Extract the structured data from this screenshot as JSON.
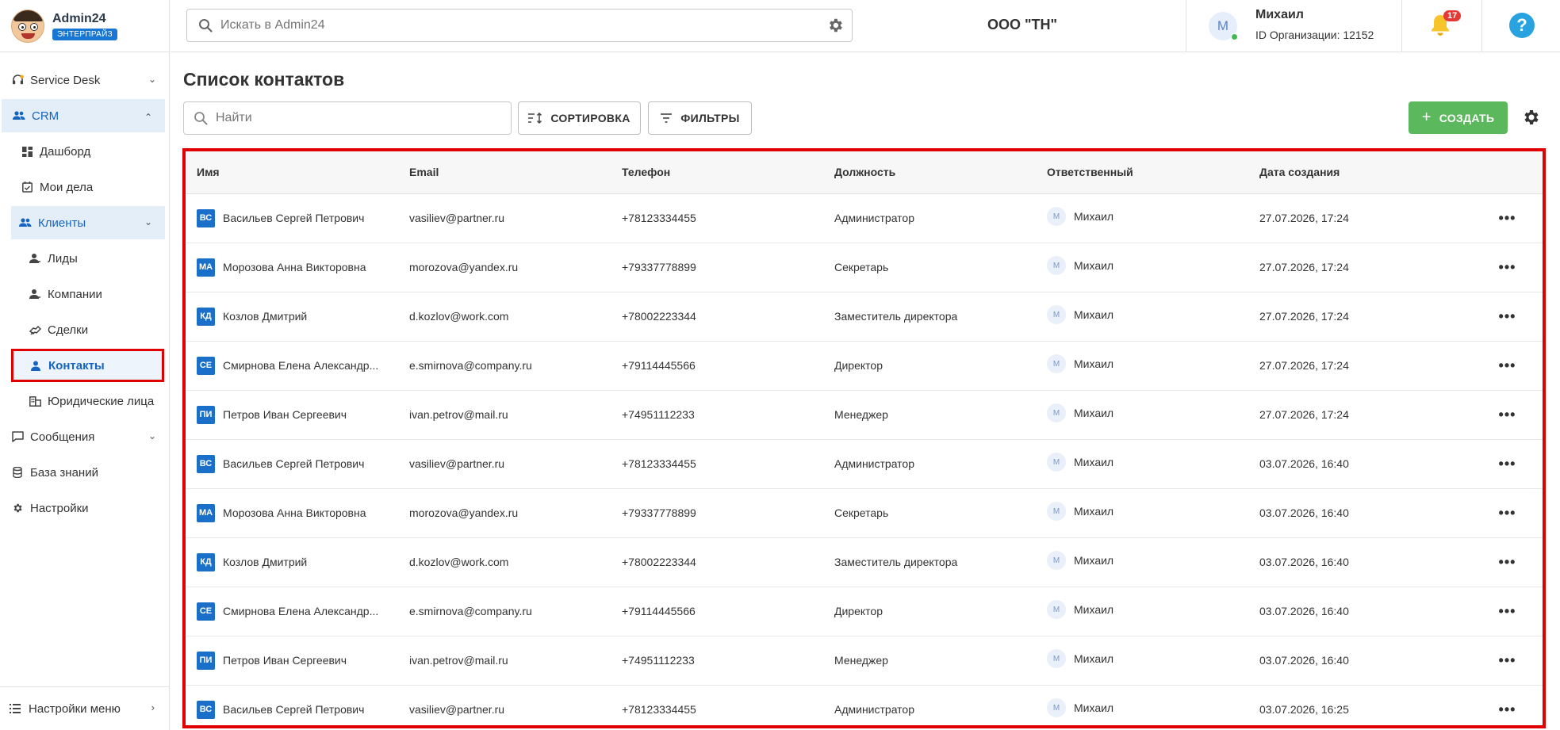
{
  "brand": {
    "title": "Admin24",
    "badge": "ЭНТЕРПРАЙЗ"
  },
  "sidebar": {
    "items": [
      {
        "label": "Service Desk",
        "icon": "headset-icon"
      },
      {
        "label": "CRM",
        "icon": "people-icon"
      },
      {
        "label": "Дашборд",
        "icon": "dashboard-icon"
      },
      {
        "label": "Мои дела",
        "icon": "calendar-check-icon"
      },
      {
        "label": "Клиенты",
        "icon": "clients-icon"
      },
      {
        "label": "Лиды",
        "icon": "lead-icon"
      },
      {
        "label": "Компании",
        "icon": "company-icon"
      },
      {
        "label": "Сделки",
        "icon": "handshake-icon"
      },
      {
        "label": "Контакты",
        "icon": "person-icon"
      },
      {
        "label": "Юридические лица",
        "icon": "building-icon"
      },
      {
        "label": "Сообщения",
        "icon": "chat-icon"
      },
      {
        "label": "База знаний",
        "icon": "database-icon"
      },
      {
        "label": "Настройки",
        "icon": "gear-icon"
      }
    ],
    "footer": "Настройки меню"
  },
  "header": {
    "search_placeholder": "Искать в Admin24",
    "org_name": "ООО \"ТН\"",
    "user_initial": "М",
    "user_name": "Михаил",
    "user_org": "ID Организации: 12152",
    "notifications": "17",
    "help": "?"
  },
  "main": {
    "title": "Список контактов",
    "find_placeholder": "Найти",
    "sort_label": "СОРТИРОВКА",
    "filter_label": "ФИЛЬТРЫ",
    "create_label": "СОЗДАТЬ"
  },
  "table": {
    "columns": [
      "Имя",
      "Email",
      "Телефон",
      "Должность",
      "Ответственный",
      "Дата создания"
    ],
    "rows": [
      {
        "initials": "ВС",
        "name": "Васильев Сергей Петрович",
        "email": "vasiliev@partner.ru",
        "phone": "+78123334455",
        "position": "Администратор",
        "resp_initial": "М",
        "resp": "Михаил",
        "date": "27.07.2026, 17:24"
      },
      {
        "initials": "МА",
        "name": "Морозова Анна Викторовна",
        "email": "morozova@yandex.ru",
        "phone": "+79337778899",
        "position": "Секретарь",
        "resp_initial": "М",
        "resp": "Михаил",
        "date": "27.07.2026, 17:24"
      },
      {
        "initials": "КД",
        "name": "Козлов Дмитрий",
        "email": "d.kozlov@work.com",
        "phone": "+78002223344",
        "position": "Заместитель директора",
        "resp_initial": "М",
        "resp": "Михаил",
        "date": "27.07.2026, 17:24"
      },
      {
        "initials": "СЕ",
        "name": "Смирнова Елена Александр...",
        "email": "e.smirnova@company.ru",
        "phone": "+79114445566",
        "position": "Директор",
        "resp_initial": "М",
        "resp": "Михаил",
        "date": "27.07.2026, 17:24"
      },
      {
        "initials": "ПИ",
        "name": "Петров Иван Сергеевич",
        "email": "ivan.petrov@mail.ru",
        "phone": "+74951112233",
        "position": "Менеджер",
        "resp_initial": "М",
        "resp": "Михаил",
        "date": "27.07.2026, 17:24"
      },
      {
        "initials": "ВС",
        "name": "Васильев Сергей Петрович",
        "email": "vasiliev@partner.ru",
        "phone": "+78123334455",
        "position": "Администратор",
        "resp_initial": "М",
        "resp": "Михаил",
        "date": "03.07.2026, 16:40"
      },
      {
        "initials": "МА",
        "name": "Морозова Анна Викторовна",
        "email": "morozova@yandex.ru",
        "phone": "+79337778899",
        "position": "Секретарь",
        "resp_initial": "М",
        "resp": "Михаил",
        "date": "03.07.2026, 16:40"
      },
      {
        "initials": "КД",
        "name": "Козлов Дмитрий",
        "email": "d.kozlov@work.com",
        "phone": "+78002223344",
        "position": "Заместитель директора",
        "resp_initial": "М",
        "resp": "Михаил",
        "date": "03.07.2026, 16:40"
      },
      {
        "initials": "СЕ",
        "name": "Смирнова Елена Александр...",
        "email": "e.smirnova@company.ru",
        "phone": "+79114445566",
        "position": "Директор",
        "resp_initial": "М",
        "resp": "Михаил",
        "date": "03.07.2026, 16:40"
      },
      {
        "initials": "ПИ",
        "name": "Петров Иван Сергеевич",
        "email": "ivan.petrov@mail.ru",
        "phone": "+74951112233",
        "position": "Менеджер",
        "resp_initial": "М",
        "resp": "Михаил",
        "date": "03.07.2026, 16:40"
      },
      {
        "initials": "ВС",
        "name": "Васильев Сергей Петрович",
        "email": "vasiliev@partner.ru",
        "phone": "+78123334455",
        "position": "Администратор",
        "resp_initial": "М",
        "resp": "Михаил",
        "date": "03.07.2026, 16:25"
      }
    ],
    "row_menu": "•••"
  },
  "colors": {
    "accent": "#1976d2",
    "create": "#5cb85c",
    "highlight": "#e00000",
    "badge": "#e53935"
  }
}
